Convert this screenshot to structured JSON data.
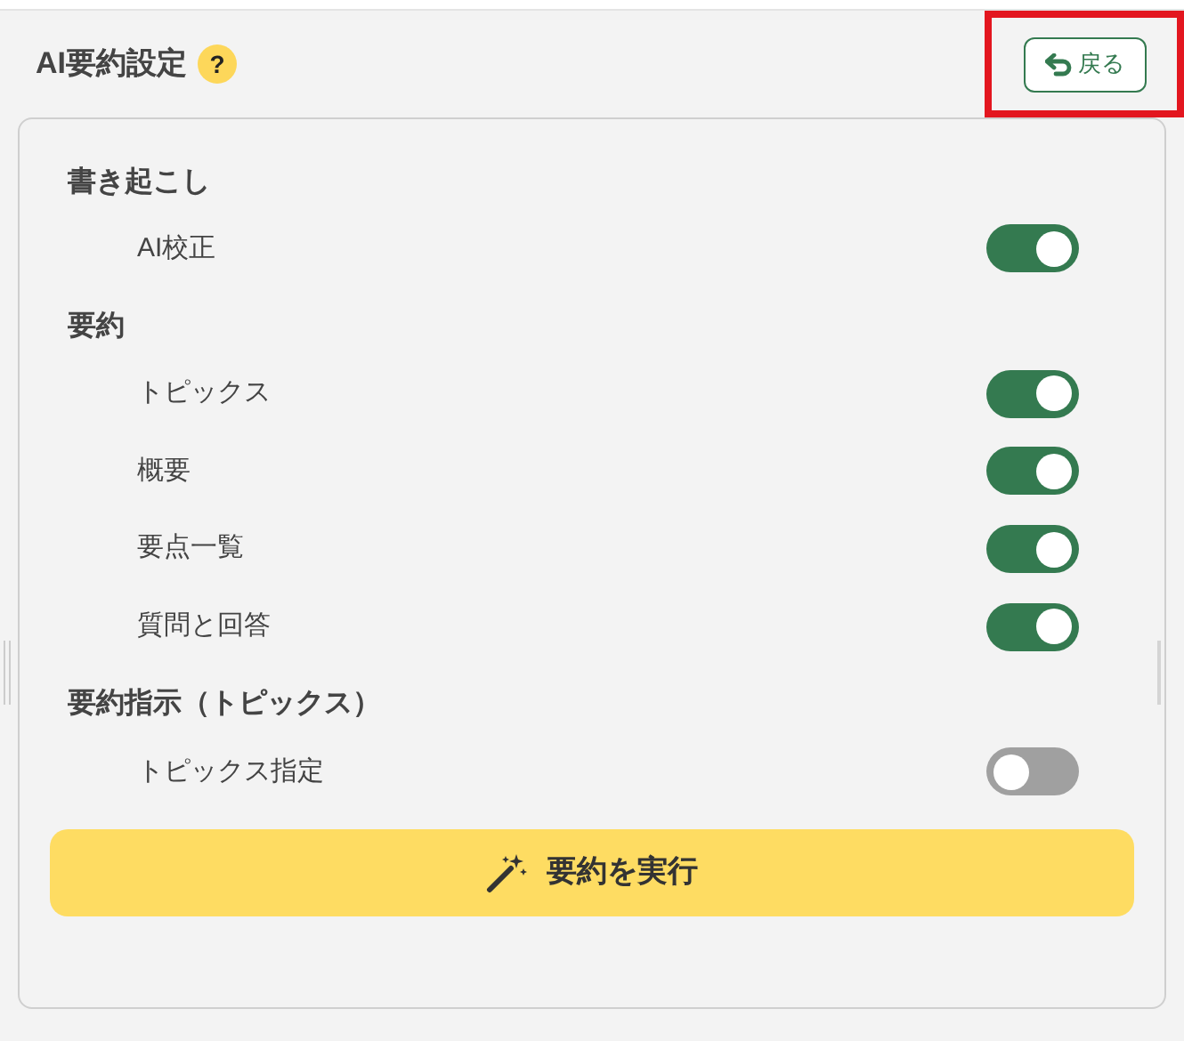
{
  "header": {
    "title": "AI要約設定",
    "help": "?",
    "back_button": "戻る",
    "highlighted": true
  },
  "sections": [
    {
      "title": "書き起こし",
      "items": [
        {
          "label": "AI校正",
          "on": true
        }
      ]
    },
    {
      "title": "要約",
      "items": [
        {
          "label": "トピックス",
          "on": true
        },
        {
          "label": "概要",
          "on": true
        },
        {
          "label": "要点一覧",
          "on": true
        },
        {
          "label": "質問と回答",
          "on": true
        }
      ]
    },
    {
      "title": "要約指示（トピックス）",
      "items": [
        {
          "label": "トピックス指定",
          "on": false
        }
      ]
    }
  ],
  "run_button": "要約を実行"
}
